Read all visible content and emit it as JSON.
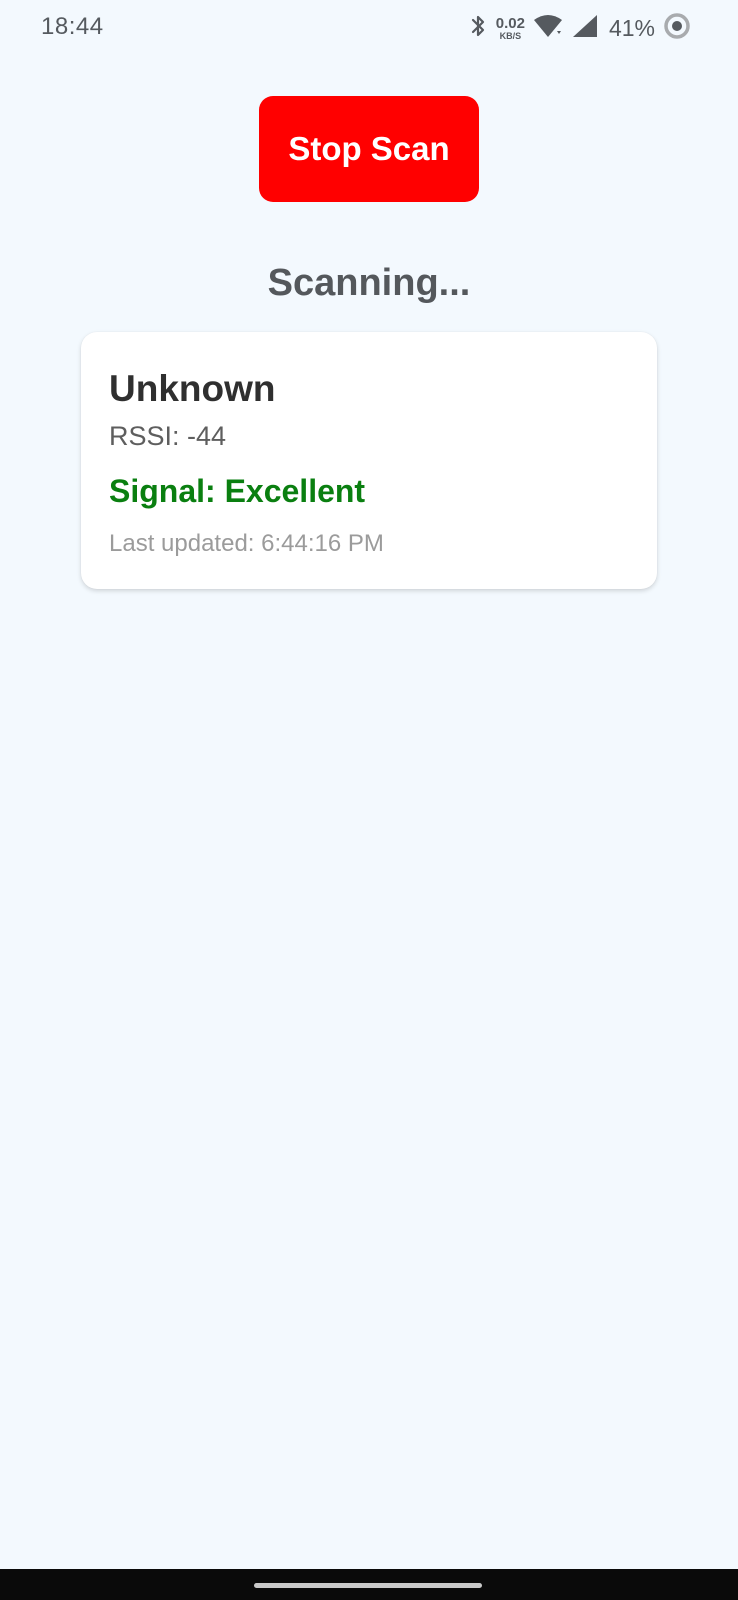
{
  "status_bar": {
    "time": "18:44",
    "net_speed_value": "0.02",
    "net_speed_unit": "KB/S",
    "battery": "41%",
    "icons": [
      "bluetooth-icon",
      "wifi-icon",
      "cell-signal-icon",
      "battery-ring-icon"
    ]
  },
  "actions": {
    "stop_scan_label": "Stop Scan"
  },
  "scan": {
    "status": "Scanning..."
  },
  "device": {
    "name": "Unknown",
    "rssi": "RSSI: -44",
    "signal": "Signal: Excellent",
    "last_updated": "Last updated: 6:44:16 PM"
  },
  "colors": {
    "stop_button": "#ff0000",
    "signal_excellent": "#0a7f10",
    "background": "#f3f9fe"
  }
}
